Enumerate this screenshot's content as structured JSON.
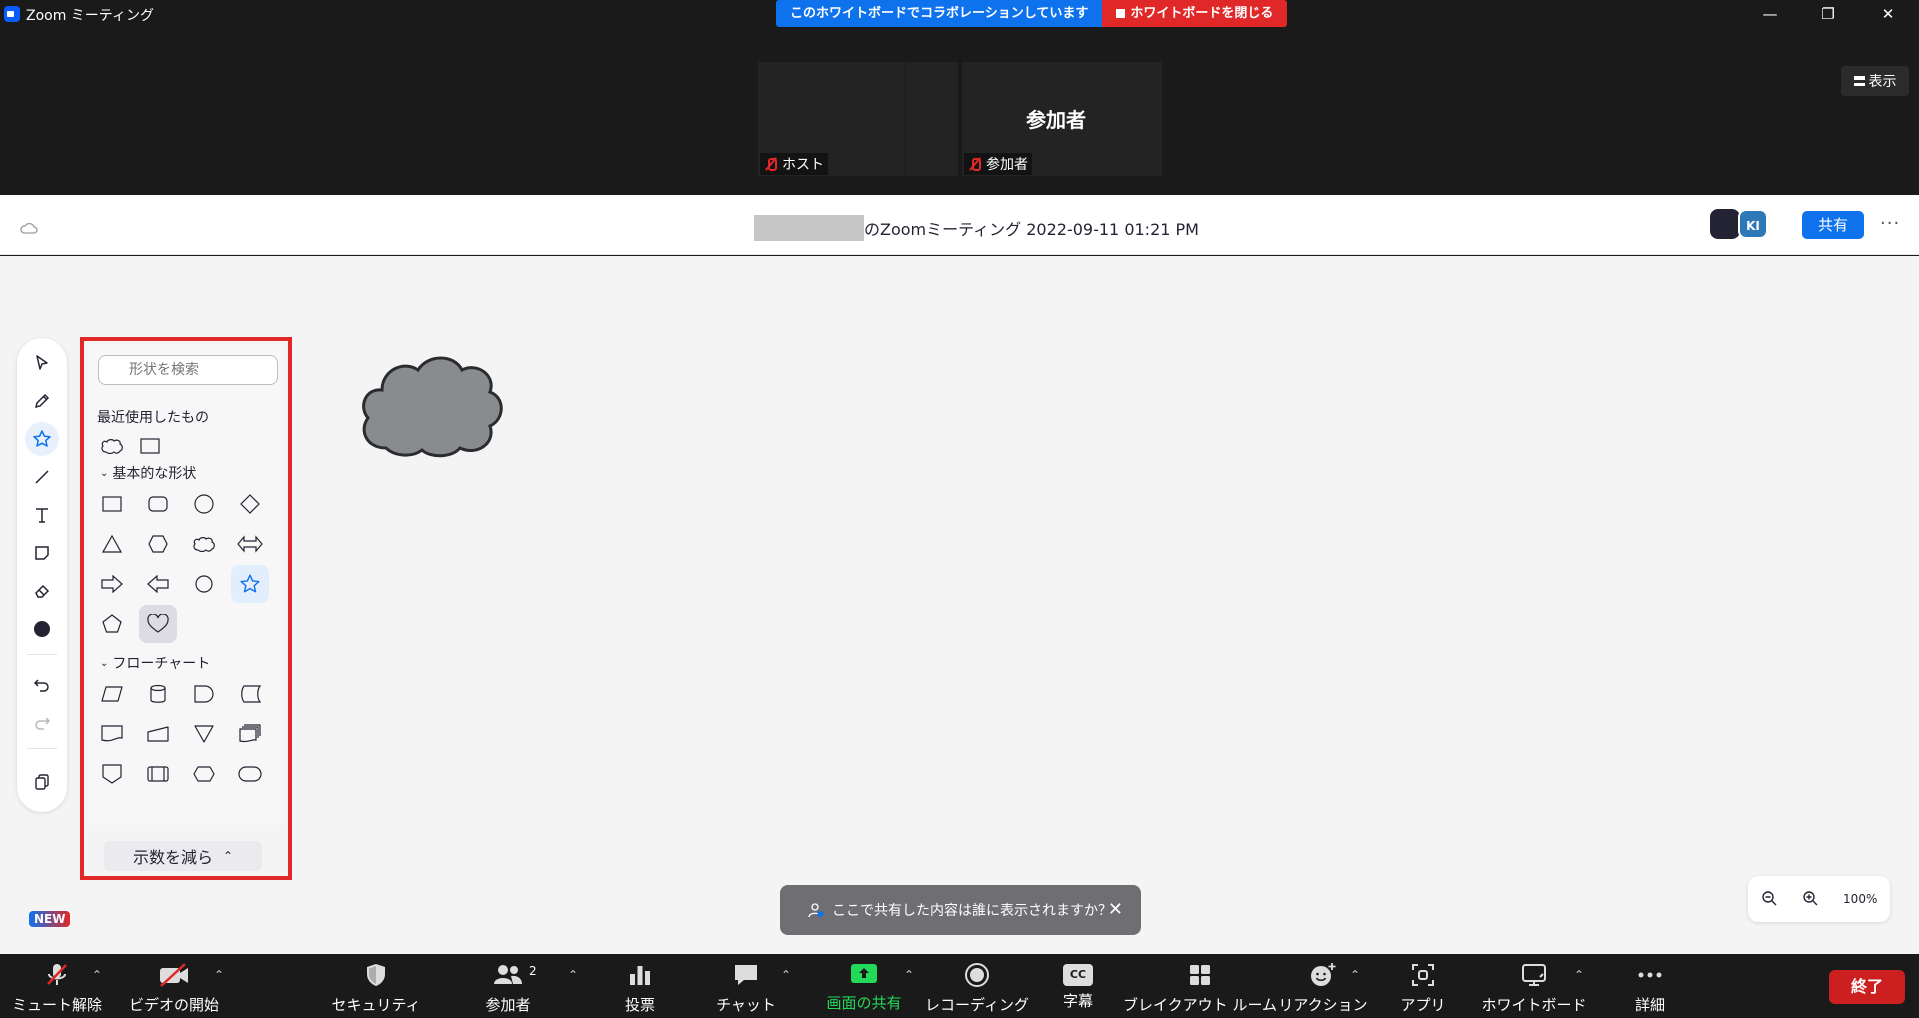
{
  "window": {
    "title": "Zoom ミーティング"
  },
  "banner": {
    "collab_text": "このホワイトボードでコラボレーションしています",
    "close_label": "ホワイトボードを閉じる"
  },
  "video": {
    "tiles": [
      {
        "name": "ホスト"
      },
      {
        "name": "参加者",
        "big_label": "参加者"
      }
    ],
    "view_label": "表示"
  },
  "whiteboard": {
    "title_suffix": "のZoomミーティング 2022-09-11 01:21 PM",
    "share_label": "共有",
    "avatar_initials": "KI",
    "more": "···"
  },
  "shapes_panel": {
    "search_placeholder": "形状を検索",
    "recent_title": "最近使用したもの",
    "basic_title": "基本的な形状",
    "flow_title": "フローチャート",
    "reduce_label": "示数を減ら"
  },
  "new_badge": "NEW",
  "toast": {
    "text": "ここで共有した内容は誰に表示されますか？",
    "close": "✕"
  },
  "zoom": {
    "level": "100%"
  },
  "bottom_bar": {
    "unmute": "ミュート解除",
    "video": "ビデオの開始",
    "security": "セキュリティ",
    "participants": "参加者",
    "participants_count": "2",
    "polls": "投票",
    "chat": "チャット",
    "share_screen": "画面の共有",
    "recording": "レコーディング",
    "captions": "字幕",
    "captions_icon": "CC",
    "breakout": "ブレイクアウト ルーム",
    "reactions": "リアクション",
    "apps": "アプリ",
    "whiteboard": "ホワイトボード",
    "more": "詳細",
    "end": "終了"
  },
  "colors": {
    "accent": "#0e72ed",
    "danger": "#e02828",
    "share_green": "#23d959"
  }
}
